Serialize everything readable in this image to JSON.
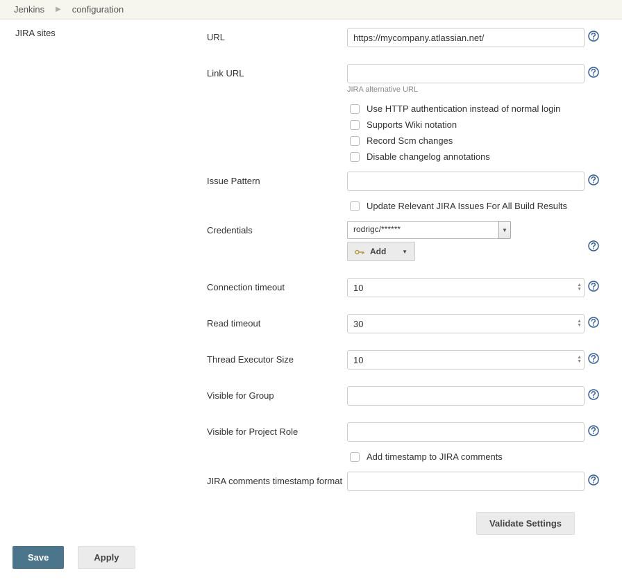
{
  "breadcrumb": {
    "root": "Jenkins",
    "current": "configuration"
  },
  "section": {
    "title": "JIRA sites"
  },
  "fields": {
    "url": {
      "label": "URL",
      "value": "https://mycompany.atlassian.net/"
    },
    "link_url": {
      "label": "Link URL",
      "value": "",
      "helper": "JIRA alternative URL"
    },
    "issue_pattern": {
      "label": "Issue Pattern",
      "value": ""
    },
    "credentials": {
      "label": "Credentials",
      "value": "rodrigc/******",
      "add_label": "Add"
    },
    "conn_timeout": {
      "label": "Connection timeout",
      "value": "10"
    },
    "read_timeout": {
      "label": "Read timeout",
      "value": "30"
    },
    "thread_exec": {
      "label": "Thread Executor Size",
      "value": "10"
    },
    "visible_group": {
      "label": "Visible for Group",
      "value": ""
    },
    "visible_role": {
      "label": "Visible for Project Role",
      "value": ""
    },
    "ts_format": {
      "label": "JIRA comments timestamp format",
      "value": ""
    }
  },
  "checkboxes": {
    "http_auth": "Use HTTP authentication instead of normal login",
    "wiki": "Supports Wiki notation",
    "scm": "Record Scm changes",
    "disable_changelog": "Disable changelog annotations",
    "update_issues": "Update Relevant JIRA Issues For All Build Results",
    "add_ts": "Add timestamp to JIRA comments"
  },
  "buttons": {
    "validate": "Validate Settings",
    "save": "Save",
    "apply": "Apply"
  }
}
